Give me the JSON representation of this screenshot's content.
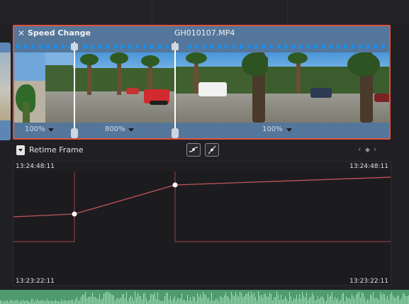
{
  "clip": {
    "title": "Speed Change",
    "filename": "GH010107.MP4",
    "selected_border_color": "#e0533f",
    "clip_color": "#55769b",
    "speed_segments": [
      {
        "label": "100%"
      },
      {
        "label": "800%"
      },
      {
        "label": "100%"
      }
    ],
    "speed_arrow_color": "#1d8fe8"
  },
  "retime": {
    "label": "Retime Frame",
    "nav_prev": "‹",
    "nav_key": "◆",
    "nav_next": "›"
  },
  "graph": {
    "top_left_tc": "13:24:48:11",
    "top_right_tc": "13:24:48:11",
    "bottom_left_tc": "13:23:22:11",
    "bottom_right_tc": "13:23:22:11",
    "curve_color": "#c2565b"
  },
  "icons": {
    "close": "close-icon",
    "retime_dropdown": "chevron-down-icon",
    "curve_ease": "ease-curve-icon",
    "curve_linear": "linear-curve-icon"
  }
}
